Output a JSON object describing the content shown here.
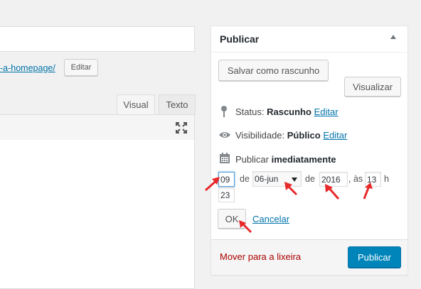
{
  "editor": {
    "permalink_text": "-a-homepage/",
    "edit_permalink_label": "Editar",
    "tab_visual": "Visual",
    "tab_text": "Texto"
  },
  "publish": {
    "title": "Publicar",
    "save_draft_label": "Salvar como rascunho",
    "preview_label": "Visualizar",
    "status_label": "Status:",
    "status_value": "Rascunho",
    "status_edit": "Editar",
    "visibility_label": "Visibilidade:",
    "visibility_value": "Público",
    "visibility_edit": "Editar",
    "schedule_label": "Publicar",
    "schedule_value": "imediatamente",
    "day": "09",
    "de1": "de",
    "month": "06-jun",
    "de2": "de",
    "year": "2016",
    "as": ", às",
    "hour": "13",
    "h": "h",
    "minute": "23",
    "ok_label": "OK",
    "cancel_label": "Cancelar",
    "trash_label": "Mover para a lixeira",
    "publish_label": "Publicar"
  },
  "colors": {
    "primary": "#0085ba",
    "link": "#0073aa",
    "danger": "#a00",
    "annotation": "#e8292b"
  }
}
